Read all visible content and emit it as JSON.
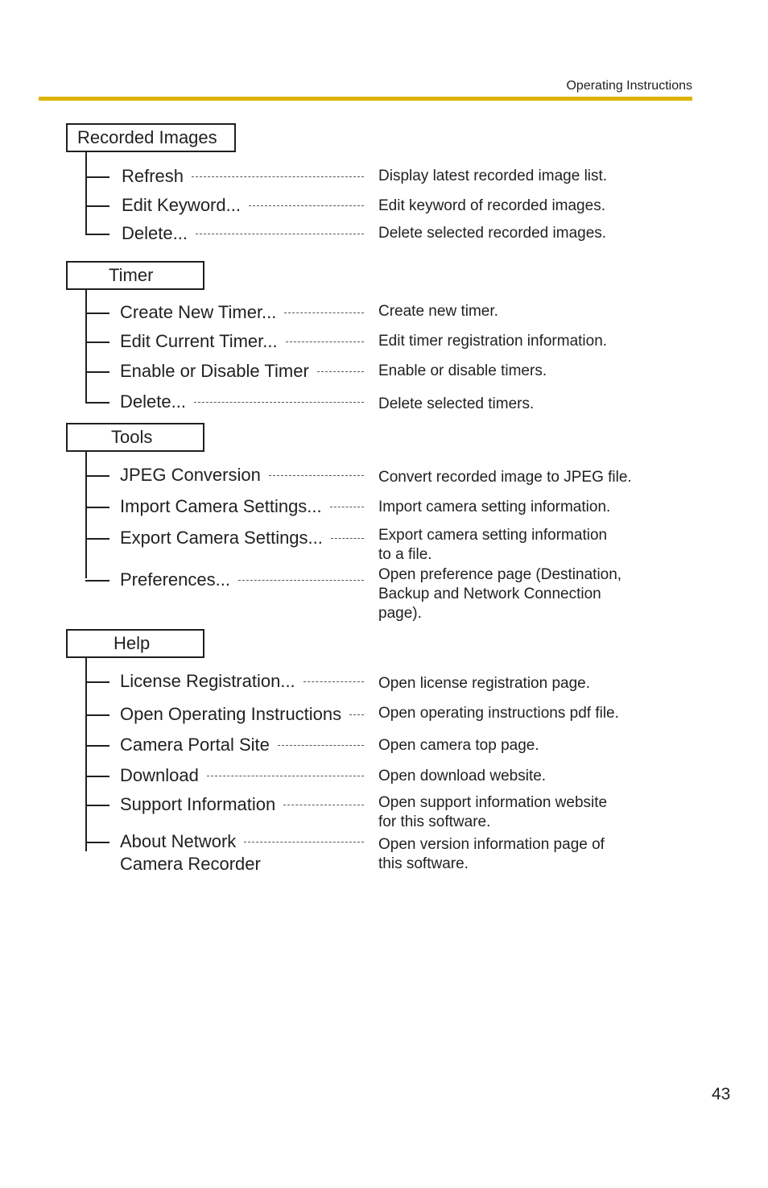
{
  "header": {
    "title": "Operating Instructions",
    "accent_color": "#dcb500"
  },
  "page_number": "43",
  "sections": [
    {
      "title": "Recorded Images",
      "items": [
        {
          "label": "Refresh",
          "description": "Display latest recorded image list."
        },
        {
          "label": "Edit Keyword...",
          "description": "Edit keyword of recorded images."
        },
        {
          "label": "Delete...",
          "description": "Delete selected recorded images."
        }
      ]
    },
    {
      "title": "Timer",
      "items": [
        {
          "label": "Create New Timer...",
          "description": "Create new timer."
        },
        {
          "label": "Edit Current Timer...",
          "description": "Edit timer registration information."
        },
        {
          "label": "Enable or Disable Timer",
          "description": "Enable or disable timers."
        },
        {
          "label": "Delete...",
          "description": "Delete selected timers."
        }
      ]
    },
    {
      "title": "Tools",
      "items": [
        {
          "label": "JPEG Conversion",
          "description": "Convert recorded image to JPEG file."
        },
        {
          "label": "Import Camera Settings...",
          "description": "Import camera setting information."
        },
        {
          "label": "Export Camera Settings...",
          "description": "Export camera setting information\nto a file."
        },
        {
          "label": "Preferences...",
          "description": "Open preference page (Destination,\nBackup and Network Connection\npage)."
        }
      ]
    },
    {
      "title": "Help",
      "items": [
        {
          "label": "License Registration...",
          "description": "Open license registration page."
        },
        {
          "label": "Open Operating Instructions",
          "description": "Open operating instructions pdf file."
        },
        {
          "label": "Camera Portal Site",
          "description": "Open camera top page."
        },
        {
          "label": "Download",
          "description": "Open download website."
        },
        {
          "label": "Support Information",
          "description": "Open support information website\nfor this software."
        },
        {
          "label": "About Network\nCamera Recorder",
          "description": "Open version information page of\nthis software."
        }
      ]
    }
  ]
}
